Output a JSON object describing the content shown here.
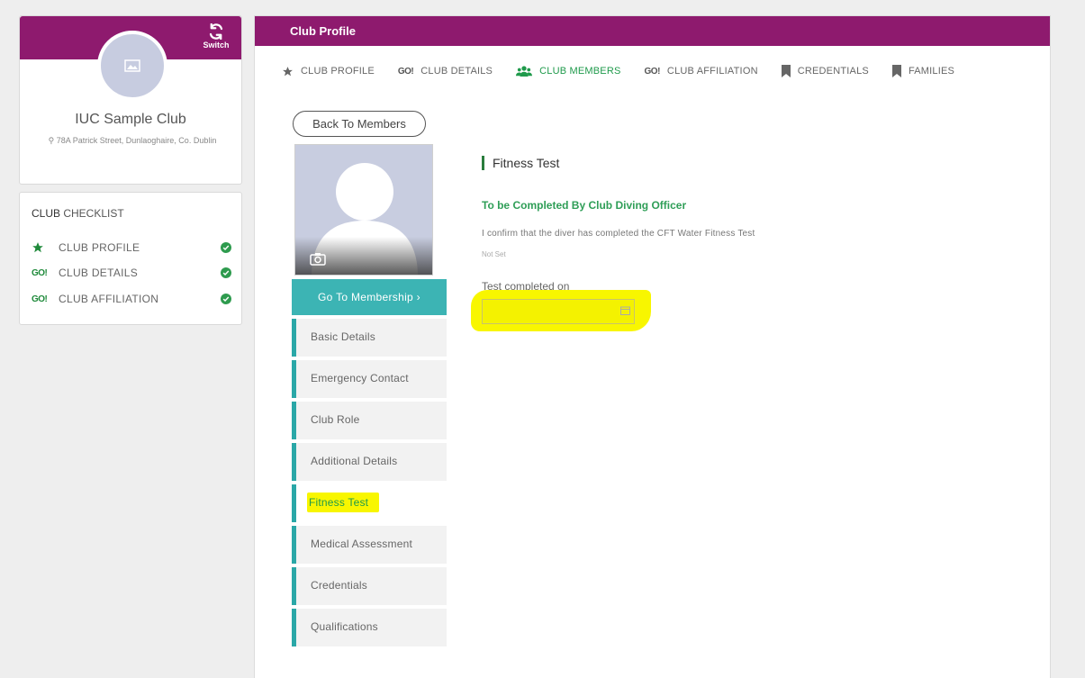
{
  "club": {
    "switch_label": "Switch",
    "name": "IUC Sample Club",
    "address": "78A Patrick Street, Dunlaoghaire, Co. Dublin"
  },
  "checklist": {
    "title_bold": "CLUB",
    "title_rest": " CHECKLIST",
    "items": [
      {
        "label": "CLUB PROFILE",
        "icon": "star-icon",
        "done": true
      },
      {
        "label": "CLUB DETAILS",
        "icon": "go-icon",
        "done": true
      },
      {
        "label": "CLUB AFFILIATION",
        "icon": "go-icon",
        "done": true
      }
    ]
  },
  "panel": {
    "title": "Club Profile",
    "tabs": [
      {
        "label": "CLUB PROFILE",
        "icon": "star-icon"
      },
      {
        "label": "CLUB DETAILS",
        "icon": "go-icon"
      },
      {
        "label": "CLUB MEMBERS",
        "icon": "users-icon",
        "active": true
      },
      {
        "label": "CLUB AFFILIATION",
        "icon": "go-icon"
      },
      {
        "label": "CREDENTIALS",
        "icon": "bookmark-icon"
      },
      {
        "label": "FAMILIES",
        "icon": "bookmark-icon"
      }
    ],
    "go_text": "GO!"
  },
  "member": {
    "back_label": "Back To Members",
    "go_membership_label": "Go To Membership ›",
    "nav": [
      "Basic Details",
      "Emergency Contact",
      "Club Role",
      "Additional Details",
      "Fitness Test",
      "Medical Assessment",
      "Credentials",
      "Qualifications"
    ],
    "active_index": 4
  },
  "fitness": {
    "section_title": "Fitness Test",
    "sub_title": "To be Completed By Club Diving Officer",
    "confirm_text": "I confirm that the diver has completed the CFT Water Fitness Test",
    "status": "Not Set",
    "date_label": "Test completed on",
    "date_value": ""
  },
  "colors": {
    "brand": "#8e1a6e",
    "accent_green": "#1f9a4b",
    "teal": "#3cb4b4",
    "highlight": "#f8f600"
  }
}
